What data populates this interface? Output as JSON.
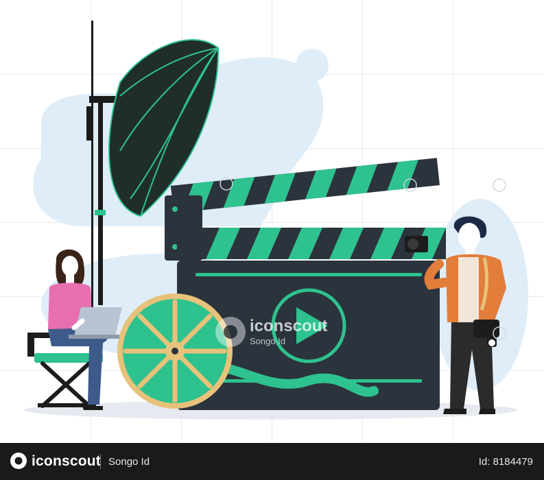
{
  "watermark": {
    "brand": "iconscout",
    "author": "Songo Id"
  },
  "footer": {
    "brand": "iconscout",
    "author": "Songo Id",
    "asset_id": "Id: 8184479"
  },
  "colors": {
    "accent_green": "#2ec28e",
    "dark_slate": "#2b333d",
    "umbrella": "#1f2e2b",
    "reel_gold": "#e8c27a",
    "shirt_pink": "#e86fb0",
    "jacket_orange": "#e27d3a",
    "blob_blue": "#deedf8"
  },
  "icons": [
    "iconscout-logo-icon",
    "play-icon",
    "film-reel-icon",
    "camera-icon",
    "laptop-icon",
    "director-chair-icon",
    "umbrella-light-icon",
    "clapperboard-icon"
  ]
}
